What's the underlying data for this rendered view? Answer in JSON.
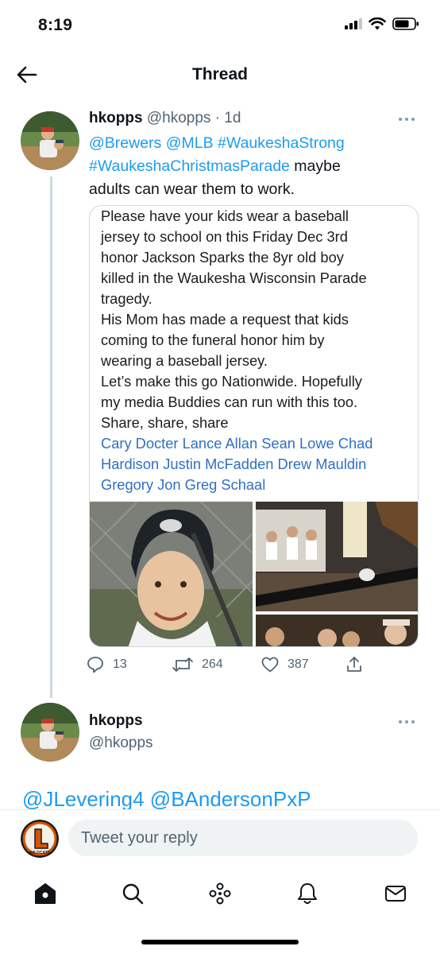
{
  "status_bar": {
    "time": "8:19"
  },
  "header": {
    "title": "Thread"
  },
  "main_tweet": {
    "display_name": "hkopps",
    "handle": "@hkopps",
    "separator": " · ",
    "age": "1d",
    "text_links_1": "@Brewers @MLB #WaukeshaStrong",
    "text_links_2": "#WaukeshaChristmasParade",
    "text_plain_1": " maybe",
    "text_plain_2": "adults can wear them to work.",
    "card_lines": [
      "Please have your kids wear a baseball",
      "jersey to school on this Friday Dec 3rd",
      "honor Jackson Sparks the 8yr old boy",
      "killed in the Waukesha Wisconsin Parade",
      "tragedy.",
      "His Mom has made a request that kids",
      "coming to the funeral honor him by",
      "wearing a baseball jersey.",
      "Let’s make this go Nationwide. Hopefully",
      "my media Buddies can run with this too.",
      "Share, share, share"
    ],
    "card_name_lines": [
      "Cary Docter Lance Allan Sean Lowe Chad",
      "Hardison Justin McFadden Drew Mauldin",
      "Gregory Jon Greg Schaal"
    ],
    "stats": {
      "replies": "13",
      "retweets": "264",
      "likes": "387"
    }
  },
  "reply_tweet": {
    "display_name": "hkopps",
    "handle": "@hkopps",
    "text": "@JLevering4 @BAndersonPxP"
  },
  "composer": {
    "placeholder": "Tweet your reply",
    "avatar_label": "WILDCATS"
  },
  "colors": {
    "link": "#1d9bf0",
    "secondary_text": "#536471",
    "card_name_link": "#2f6fc7"
  },
  "icons": {
    "back": "arrow-left-icon",
    "more": "more-horizontal-icon",
    "reply": "reply-bubble-icon",
    "retweet": "retweet-icon",
    "like": "heart-icon",
    "share": "share-icon",
    "home": "home-icon",
    "search": "search-icon",
    "spaces": "spaces-icon",
    "notifications": "bell-icon",
    "messages": "mail-icon"
  }
}
